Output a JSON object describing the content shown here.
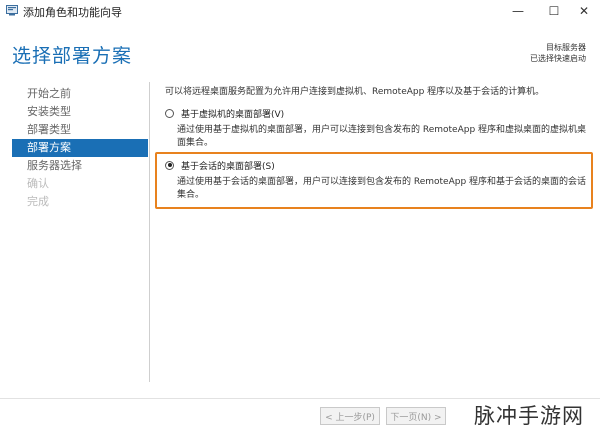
{
  "window": {
    "title": "添加角色和功能向导",
    "minimize_glyph": "—",
    "maximize_glyph": "☐",
    "close_glyph": "✕"
  },
  "page": {
    "title": "选择部署方案",
    "destination_label": "目标服务器",
    "destination_value": "已选择快速启动"
  },
  "nav": {
    "items": [
      {
        "label": "开始之前",
        "state": "normal"
      },
      {
        "label": "安装类型",
        "state": "normal"
      },
      {
        "label": "部署类型",
        "state": "normal"
      },
      {
        "label": "部署方案",
        "state": "active"
      },
      {
        "label": "服务器选择",
        "state": "normal"
      },
      {
        "label": "确认",
        "state": "disabled"
      },
      {
        "label": "完成",
        "state": "disabled"
      }
    ]
  },
  "content": {
    "intro": "可以将远程桌面服务配置为允许用户连接到虚拟机、RemoteApp 程序以及基于会话的计算机。",
    "options": [
      {
        "label": "基于虚拟机的桌面部署(V)",
        "description": "通过使用基于虚拟机的桌面部署，用户可以连接到包含发布的 RemoteApp 程序和虚拟桌面的虚拟机桌面集合。",
        "selected": false
      },
      {
        "label": "基于会话的桌面部署(S)",
        "description": "通过使用基于会话的桌面部署，用户可以连接到包含发布的 RemoteApp 程序和基于会话的桌面的会话集合。",
        "selected": true
      }
    ]
  },
  "footer": {
    "prev_label": "< 上一步(P)",
    "next_label": "下一页(N) >"
  },
  "watermark": "脉冲手游网",
  "colors": {
    "accent": "#1a6fb5",
    "highlight": "#e8821e"
  }
}
